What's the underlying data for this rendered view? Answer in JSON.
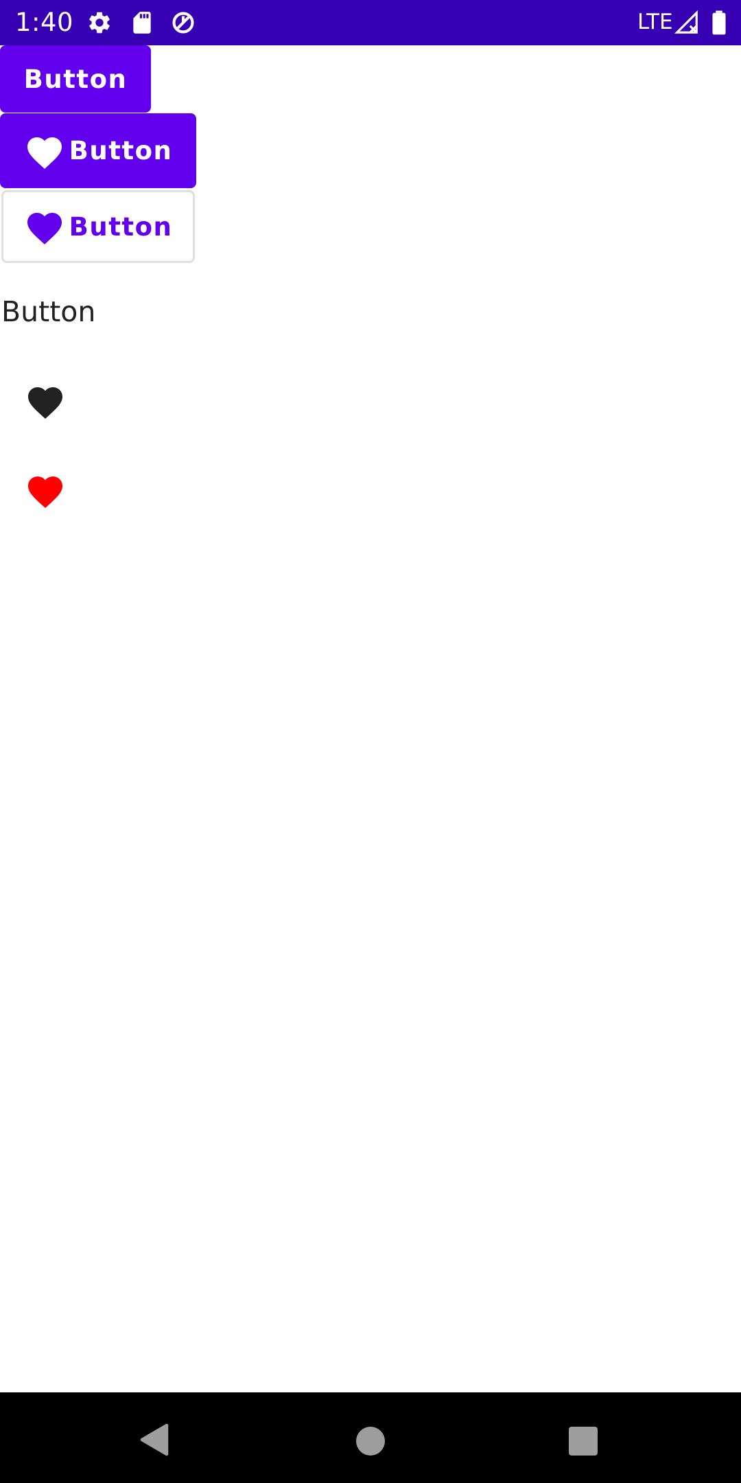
{
  "status_bar": {
    "time": "1:40",
    "network": "LTE",
    "icons": [
      "gear-icon",
      "sd-card-icon",
      "data-saver-icon",
      "signal-icon",
      "battery-icon"
    ]
  },
  "buttons": {
    "plain_label": "Button",
    "icon_label": "Button",
    "outlined_label": "Button",
    "text_label": "Button"
  },
  "icons": {
    "heart_dark": "heart-icon",
    "heart_red": "heart-icon"
  },
  "colors": {
    "status_bar": "#3700b3",
    "primary": "#6200ee",
    "heart_dark": "#212121",
    "heart_red": "#ff0000",
    "nav_bar": "#000000"
  },
  "navigation": {
    "items": [
      "back-icon",
      "home-icon",
      "recents-icon"
    ]
  }
}
